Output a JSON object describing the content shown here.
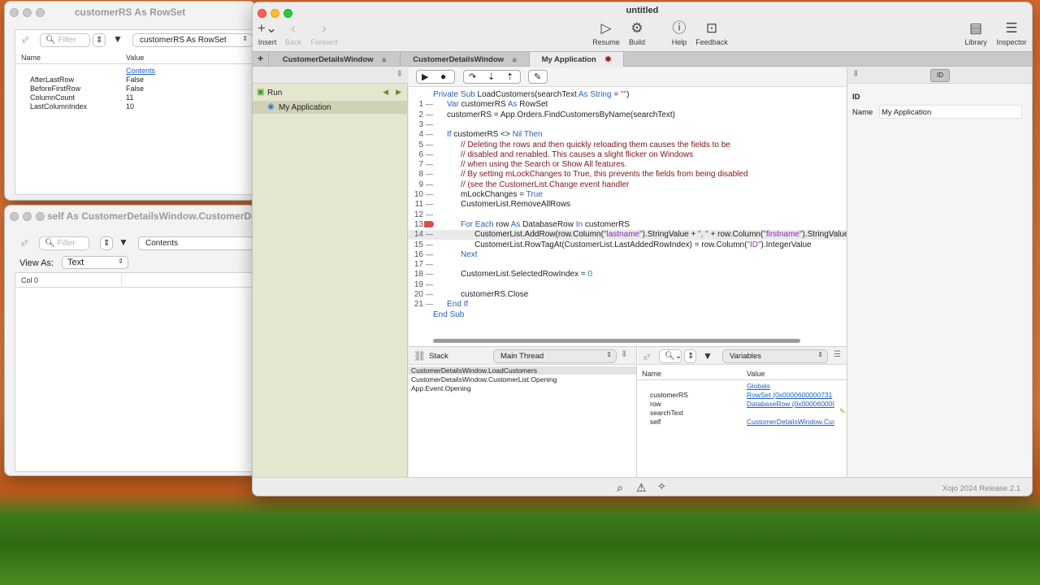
{
  "win_rowset": {
    "title": "customerRS As RowSet",
    "filter_placeholder": "Filter",
    "type_popup": "customerRS As RowSet",
    "col_name": "Name",
    "col_value": "Value",
    "contents_link": "Contents",
    "rows": [
      {
        "name": "AfterLastRow",
        "value": "False"
      },
      {
        "name": "BeforeFirstRow",
        "value": "False"
      },
      {
        "name": "ColumnCount",
        "value": "11"
      },
      {
        "name": "LastColumnIndex",
        "value": "10"
      }
    ]
  },
  "win_self": {
    "title": "self As CustomerDetailsWindow.CustomerDetailsWi",
    "filter_placeholder": "Filter",
    "contents_popup": "Contents",
    "view_as_label": "View As:",
    "view_as_value": "Text",
    "col0": "Col 0"
  },
  "main": {
    "title": "untitled",
    "toolbar": {
      "insert": "Insert",
      "back": "Back",
      "forward": "Forward",
      "resume": "Resume",
      "build": "Build",
      "help": "Help",
      "feedback": "Feedback",
      "library": "Library",
      "inspector": "Inspector"
    },
    "tabs": [
      {
        "label": "CustomerDetailsWindow"
      },
      {
        "label": "CustomerDetailsWindow"
      },
      {
        "label": "My Application"
      }
    ],
    "nav": {
      "run_label": "Run",
      "item": "My Application"
    },
    "code_lines": [
      {
        "n": "",
        "html": "<span class='kw'>Private Sub</span> LoadCustomers(searchText <span class='kw'>As String</span> = <span class='st'>\"\"</span>)",
        "indent": 0
      },
      {
        "n": "1",
        "html": "<span class='kw'>Var</span> customerRS <span class='kw'>As</span> RowSet",
        "indent": 1
      },
      {
        "n": "2",
        "html": "customerRS = App.Orders.FindCustomersByName(searchText)",
        "indent": 1
      },
      {
        "n": "3",
        "html": "",
        "indent": 1
      },
      {
        "n": "4",
        "html": "<span class='kw'>If</span> customerRS &lt;&gt; <span class='kw'>Nil Then</span>",
        "indent": 1
      },
      {
        "n": "5",
        "html": "<span class='cm'>// Deleting the rows and then quickly reloading them causes the fields to be</span>",
        "indent": 2
      },
      {
        "n": "6",
        "html": "<span class='cm'>// disabled and renabled. This causes a slight flicker on Windows</span>",
        "indent": 2
      },
      {
        "n": "7",
        "html": "<span class='cm'>// when using the Search or Show All features.</span>",
        "indent": 2
      },
      {
        "n": "8",
        "html": "<span class='cm'>// By setting mLockChanges to True, this prevents the fields from being disabled</span>",
        "indent": 2
      },
      {
        "n": "9",
        "html": "<span class='cm'>// (see the CustomerList.Change event handler</span>",
        "indent": 2
      },
      {
        "n": "10",
        "html": "mLockChanges = <span class='kw'>True</span>",
        "indent": 2
      },
      {
        "n": "11",
        "html": "CustomerList.RemoveAllRows",
        "indent": 2
      },
      {
        "n": "12",
        "html": "",
        "indent": 2
      },
      {
        "n": "13",
        "html": "<span class='kw'>For Each</span> row <span class='kw'>As</span> DatabaseRow <span class='kw'>In</span> customerRS",
        "indent": 2
      },
      {
        "n": "14",
        "html": "CustomerList.AddRow(row.Column(<span class='st'>\"lastname\"</span>).StringValue + <span class='st'>\", \"</span> + row.Column(<span class='st'>\"firstname\"</span>).StringValue)",
        "indent": 3
      },
      {
        "n": "15",
        "html": "CustomerList.RowTagAt(CustomerList.LastAddedRowIndex) = row.Column(<span class='st'>\"ID\"</span>).IntegerValue",
        "indent": 3
      },
      {
        "n": "16",
        "html": "<span class='kw'>Next</span>",
        "indent": 2
      },
      {
        "n": "17",
        "html": "",
        "indent": 2
      },
      {
        "n": "18",
        "html": "CustomerList.SelectedRowIndex = <span class='nm'>0</span>",
        "indent": 2
      },
      {
        "n": "19",
        "html": "",
        "indent": 2
      },
      {
        "n": "20",
        "html": "customerRS.Close",
        "indent": 2
      },
      {
        "n": "21",
        "html": "<span class='kw'>End If</span>",
        "indent": 1
      },
      {
        "n": "",
        "html": "<span class='kw'>End Sub</span>",
        "indent": 0
      }
    ],
    "stack": {
      "label": "Stack",
      "thread": "Main Thread",
      "frames": [
        "CustomerDetailsWindow.LoadCustomers",
        "CustomerDetailsWindow.CustomerList.Opening",
        "App.Event.Opening"
      ]
    },
    "vars": {
      "popup": "Variables",
      "col_name": "Name",
      "col_value": "Value",
      "globals": "Globals",
      "rows": [
        {
          "name": "customerRS",
          "value": "RowSet (0x0000600000731"
        },
        {
          "name": "row",
          "value": "DatabaseRow (0x000060000"
        },
        {
          "name": "searchText",
          "value": ""
        },
        {
          "name": "self",
          "value": "CustomerDetailsWindow.Cus"
        }
      ]
    },
    "inspector": {
      "section": "ID",
      "name_label": "Name",
      "name_value": "My Application"
    },
    "status": {
      "version": "Xojo 2024 Release 2.1"
    }
  }
}
